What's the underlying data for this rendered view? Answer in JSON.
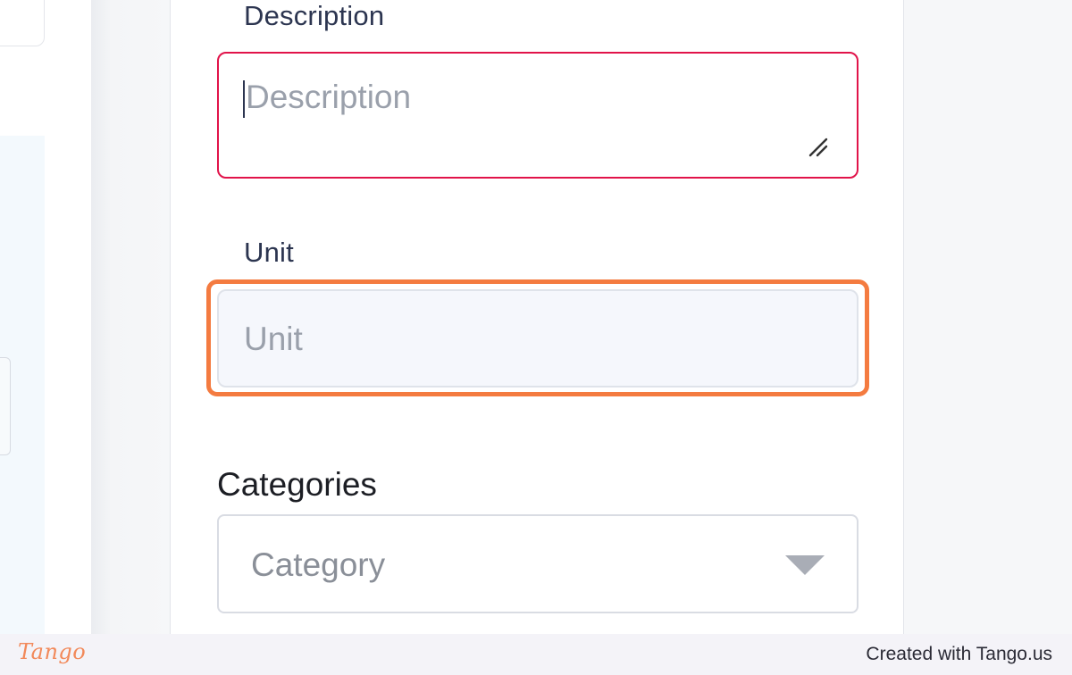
{
  "form": {
    "description": {
      "label": "Description",
      "placeholder": "Description"
    },
    "unit": {
      "label": "Unit",
      "placeholder": "Unit"
    },
    "categories": {
      "label": "Categories",
      "placeholder": "Category"
    }
  },
  "footer": {
    "logo_text": "Tango",
    "credit": "Created with Tango.us"
  },
  "colors": {
    "error_border": "#e1134a",
    "highlight": "#f47b40",
    "logo": "#f2895a"
  },
  "icons": [
    "resize-handle-icon",
    "chevron-down-icon"
  ]
}
